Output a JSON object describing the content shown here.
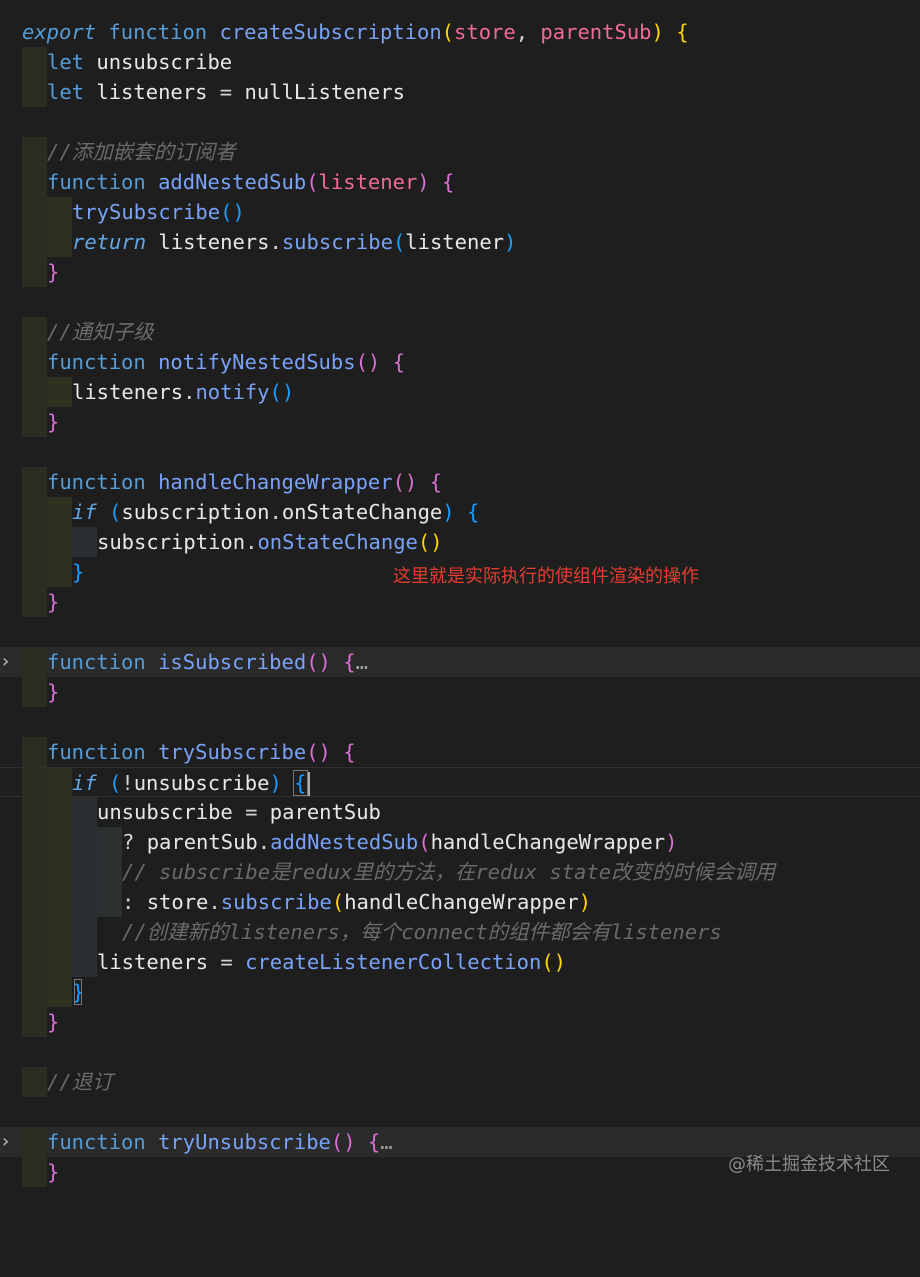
{
  "code": {
    "line1": {
      "export": "export",
      "function": "function",
      "name": "createSubscription",
      "open": "(",
      "p1": "store",
      "comma": ", ",
      "p2": "parentSub",
      "close": ")",
      "brace": "{"
    },
    "line2": {
      "kw": "let",
      "name": "unsubscribe"
    },
    "line3": {
      "kw": "let",
      "name": "listeners",
      "eq": " = ",
      "value": "nullListeners"
    },
    "comment_nested": "//添加嵌套的订阅者",
    "line5": {
      "function": "function",
      "name": "addNestedSub",
      "open": "(",
      "param": "listener",
      "close": ")",
      "brace": "{"
    },
    "line6": {
      "call": "trySubscribe",
      "parens": "()"
    },
    "line7": {
      "return": "return",
      "obj": "listeners",
      "dot": ".",
      "method": "subscribe",
      "open": "(",
      "arg": "listener",
      "close": ")"
    },
    "close_brace": "}",
    "comment_notify": "//通知子级",
    "line10": {
      "function": "function",
      "name": "notifyNestedSubs",
      "parens": "()",
      "brace": "{"
    },
    "line11": {
      "obj": "listeners",
      "dot": ".",
      "method": "notify",
      "parens": "()"
    },
    "line14": {
      "function": "function",
      "name": "handleChangeWrapper",
      "parens": "()",
      "brace": "{"
    },
    "line15": {
      "if": "if",
      "open": "(",
      "obj": "subscription",
      "dot": ".",
      "prop": "onStateChange",
      "close": ")",
      "brace": "{"
    },
    "line16": {
      "obj": "subscription",
      "dot": ".",
      "method": "onStateChange",
      "parens": "()"
    },
    "line20": {
      "function": "function",
      "name": "isSubscribed",
      "parens": "()",
      "brace": "{",
      "ellipsis": "…"
    },
    "line23": {
      "function": "function",
      "name": "trySubscribe",
      "parens": "()",
      "brace": "{"
    },
    "line24": {
      "if": "if",
      "open": "(",
      "not": "!",
      "name": "unsubscribe",
      "close": ")",
      "brace": "{"
    },
    "line25": {
      "name": "unsubscribe",
      "eq": " = ",
      "value": "parentSub"
    },
    "line26": {
      "q": "? ",
      "obj": "parentSub",
      "dot": ".",
      "method": "addNestedSub",
      "open": "(",
      "arg": "handleChangeWrapper",
      "close": ")"
    },
    "comment_subscribe": "// subscribe是redux里的方法，在redux state改变的时候会调用",
    "line28": {
      "colon": ": ",
      "obj": "store",
      "dot": ".",
      "method": "subscribe",
      "open": "(",
      "arg": "handleChangeWrapper",
      "close": ")"
    },
    "comment_listeners": "//创建新的listeners，每个connect的组件都会有listeners",
    "line30": {
      "name": "listeners",
      "eq": " = ",
      "call": "createListenerCollection",
      "parens": "()"
    },
    "comment_unsub": "//退订",
    "line36": {
      "function": "function",
      "name": "tryUnsubscribe",
      "parens": "()",
      "brace": "{",
      "ellipsis": "…"
    }
  },
  "fold_icons": {
    "collapsed": "›"
  },
  "annotation": "这里就是实际执行的使组件渲染的操作",
  "watermark": "@稀土掘金技术社区"
}
